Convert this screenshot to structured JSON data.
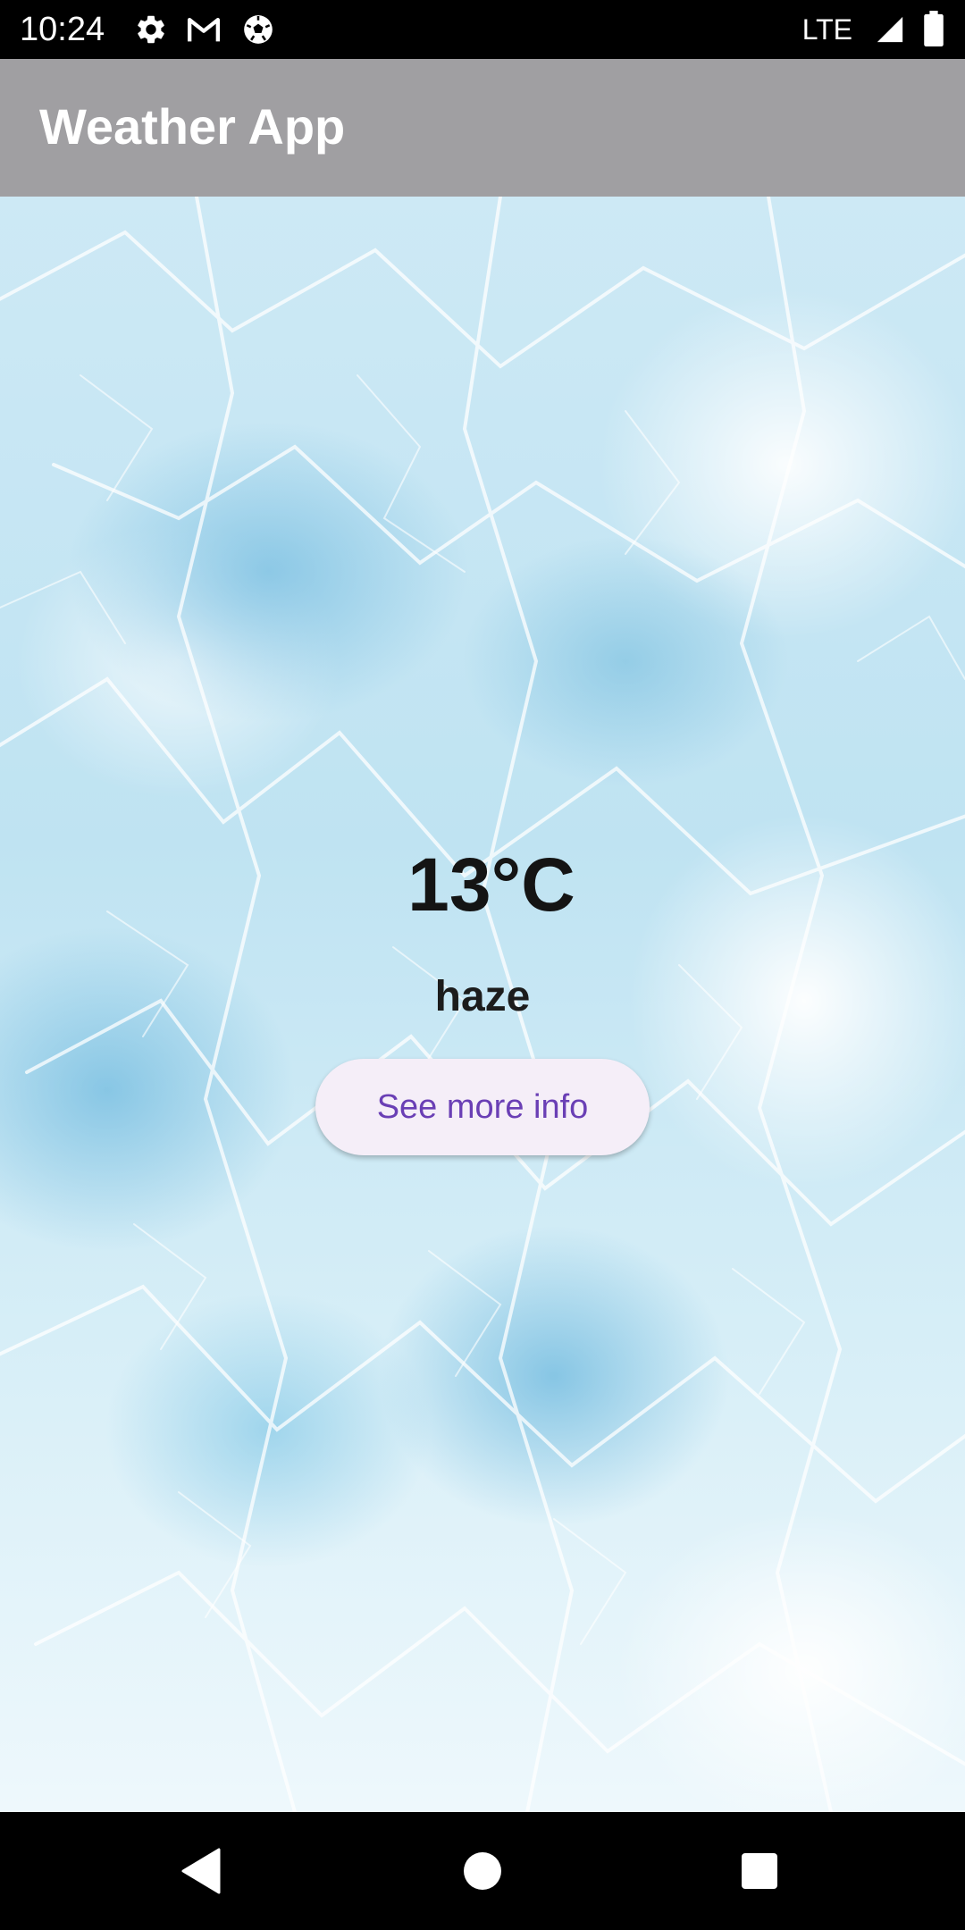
{
  "status_bar": {
    "time": "10:24",
    "network": "LTE",
    "icons": [
      "gear-icon",
      "gmail-icon",
      "soccer-ball-icon",
      "signal-icon",
      "battery-icon"
    ]
  },
  "app_bar": {
    "title": "Weather App",
    "background_color": "#a09fa2"
  },
  "weather": {
    "temperature": "13°C",
    "condition": "haze",
    "button_label": "See more info",
    "button_text_color": "#6a3fb5",
    "button_background": "#f5eef8"
  },
  "nav_bar": {
    "icons": [
      "back-icon",
      "home-icon",
      "recents-icon"
    ]
  }
}
